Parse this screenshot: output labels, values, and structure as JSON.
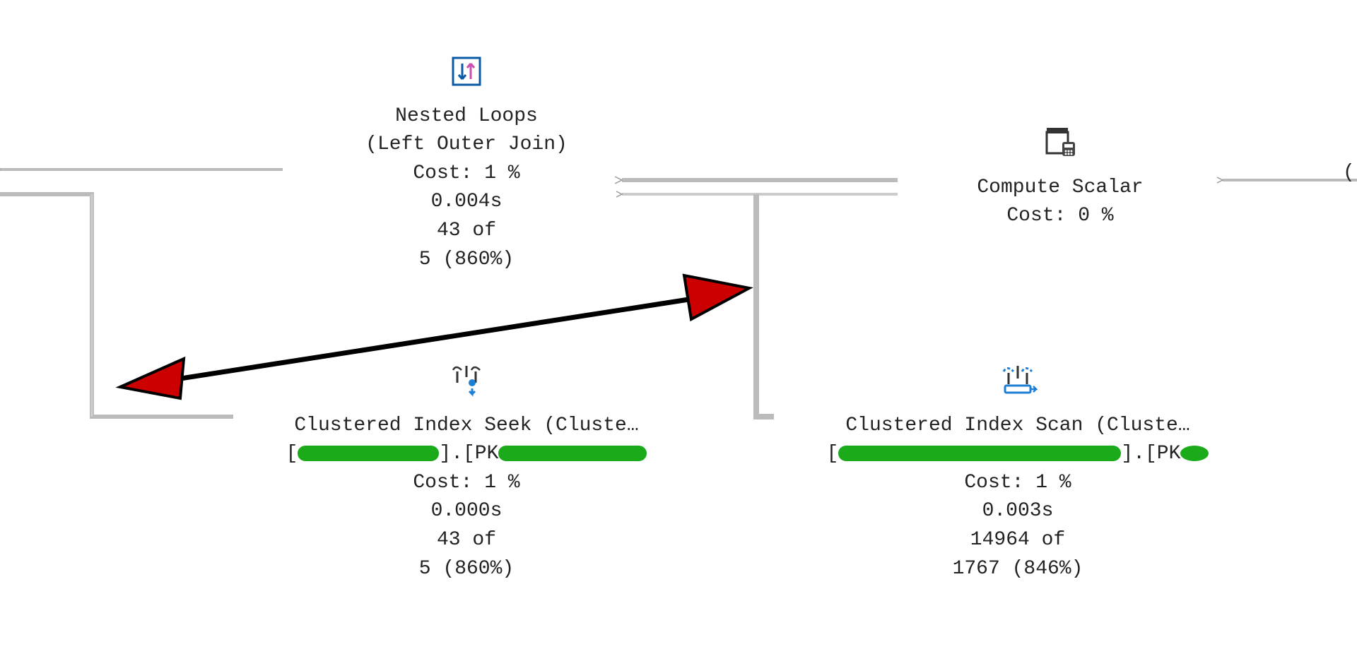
{
  "nodes": {
    "nested_loops": {
      "title": "Nested Loops",
      "subtitle": "(Left Outer Join)",
      "cost": "Cost: 1 %",
      "time": "0.004s",
      "rows_of": "43 of",
      "rows_pct": "5 (860%)"
    },
    "compute_scalar": {
      "title": "Compute Scalar",
      "cost": "Cost: 0 %"
    },
    "index_seek": {
      "title": "Clustered Index Seek (Cluste…",
      "prefix": "[",
      "mid": "].[PK",
      "cost": "Cost: 1 %",
      "time": "0.000s",
      "rows_of": "43 of",
      "rows_pct": "5 (860%)"
    },
    "index_scan": {
      "title": "Clustered Index Scan (Cluste…",
      "prefix": "[",
      "mid": "].[PK",
      "cost": "Cost: 1 %",
      "time": "0.003s",
      "rows_of": "14964 of",
      "rows_pct": "1767 (846%)"
    }
  },
  "truncated_paren": "("
}
